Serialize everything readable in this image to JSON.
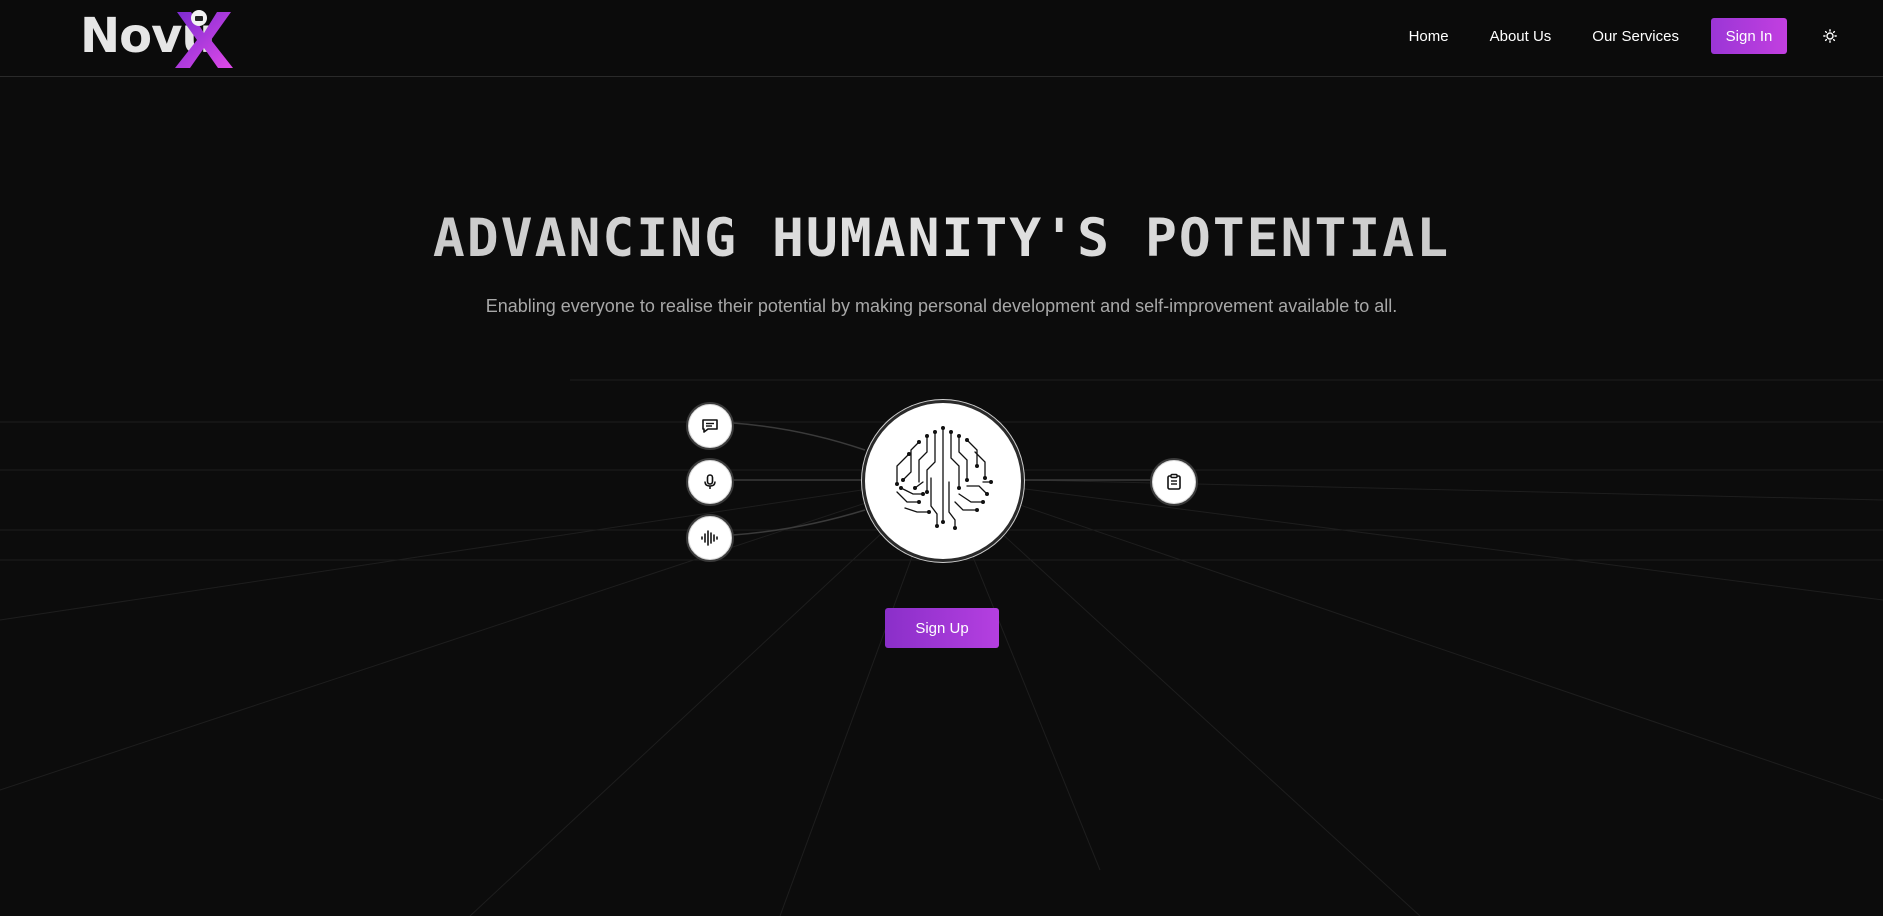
{
  "brand": {
    "name": "Novu",
    "x_letter": "X",
    "accent_from": "#9b36d6",
    "accent_to": "#d24be6"
  },
  "nav": {
    "items": [
      "Home",
      "About Us",
      "Our Services"
    ],
    "signin_label": "Sign In",
    "theme_icon": "sun-icon"
  },
  "hero": {
    "title": "ADVANCING HUMANITY'S POTENTIAL",
    "subtitle": "Enabling everyone to realise their potential by making personal development and self-improvement available to all."
  },
  "diagram": {
    "left_icons": [
      "chat-icon",
      "microphone-icon",
      "audio-waveform-icon"
    ],
    "right_icon": "clipboard-icon",
    "center_icon": "circuit-brain-icon"
  },
  "cta": {
    "signup_label": "Sign Up"
  },
  "colors": {
    "background": "#0c0c0c",
    "button": "#a23bd8",
    "text": "#ffffff",
    "subtitle": "#a8a8a8"
  }
}
